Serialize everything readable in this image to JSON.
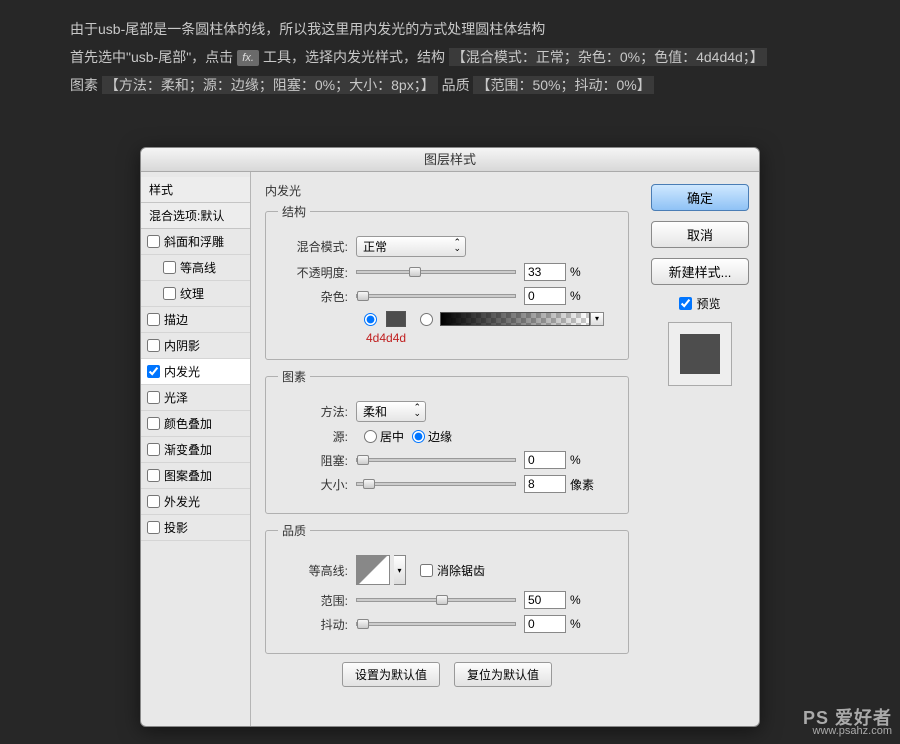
{
  "desc": {
    "line1": "由于usb-尾部是一条圆柱体的线，所以我这里用内发光的方式处理圆柱体结构",
    "line2a": "首先选中\"usb-尾部\"，点击",
    "line2b": "工具，选择内发光样式，结构",
    "line2hl1": "【混合模式：正常；杂色：0%；色值：4d4d4d；】",
    "line3a": "图素",
    "line3hl1": "【方法：柔和；源：边缘；阻塞：0%；大小：8px；】",
    "line3b": "品质",
    "line3hl2": "【范围：50%；抖动：0%】"
  },
  "dialog": {
    "title": "图层样式"
  },
  "sidebar": {
    "styles": "样式",
    "blend": "混合选项:默认",
    "items": [
      {
        "label": "斜面和浮雕",
        "checked": false,
        "indent": false
      },
      {
        "label": "等高线",
        "checked": false,
        "indent": true
      },
      {
        "label": "纹理",
        "checked": false,
        "indent": true
      },
      {
        "label": "描边",
        "checked": false,
        "indent": false
      },
      {
        "label": "内阴影",
        "checked": false,
        "indent": false
      },
      {
        "label": "内发光",
        "checked": true,
        "indent": false,
        "selected": true
      },
      {
        "label": "光泽",
        "checked": false,
        "indent": false
      },
      {
        "label": "颜色叠加",
        "checked": false,
        "indent": false
      },
      {
        "label": "渐变叠加",
        "checked": false,
        "indent": false
      },
      {
        "label": "图案叠加",
        "checked": false,
        "indent": false
      },
      {
        "label": "外发光",
        "checked": false,
        "indent": false
      },
      {
        "label": "投影",
        "checked": false,
        "indent": false
      }
    ]
  },
  "panel": {
    "heading": "内发光",
    "structure": {
      "legend": "结构",
      "blendmode_label": "混合模式:",
      "blendmode_value": "正常",
      "opacity_label": "不透明度:",
      "opacity_value": "33",
      "noise_label": "杂色:",
      "noise_value": "0",
      "color_hex": "4d4d4d"
    },
    "elements": {
      "legend": "图素",
      "method_label": "方法:",
      "method_value": "柔和",
      "source_label": "源:",
      "source_center": "居中",
      "source_edge": "边缘",
      "choke_label": "阻塞:",
      "choke_value": "0",
      "size_label": "大小:",
      "size_value": "8",
      "size_unit": "像素"
    },
    "quality": {
      "legend": "品质",
      "contour_label": "等高线:",
      "antialias": "消除锯齿",
      "range_label": "范围:",
      "range_value": "50",
      "jitter_label": "抖动:",
      "jitter_value": "0"
    },
    "pct": "%",
    "defaults_set": "设置为默认值",
    "defaults_reset": "复位为默认值"
  },
  "right": {
    "ok": "确定",
    "cancel": "取消",
    "newstyle": "新建样式...",
    "preview": "预览"
  },
  "watermark": {
    "brand": "PS 爱好者",
    "url": "www.psahz.com"
  }
}
